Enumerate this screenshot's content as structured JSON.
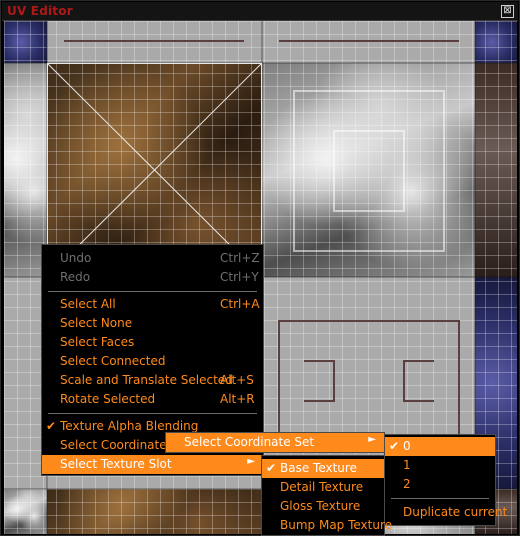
{
  "window": {
    "title": "UV Editor",
    "close_glyph": "⊠"
  },
  "colors": {
    "accent": "#ff8a1c",
    "disabled": "#6f6f6f",
    "title": "#b01818"
  },
  "context_menu": {
    "items": [
      {
        "label": "Undo",
        "shortcut": "Ctrl+Z",
        "disabled": true
      },
      {
        "label": "Redo",
        "shortcut": "Ctrl+Y",
        "disabled": true
      },
      {
        "label": "Select All",
        "shortcut": "Ctrl+A"
      },
      {
        "label": "Select None",
        "shortcut": ""
      },
      {
        "label": "Select Faces",
        "shortcut": ""
      },
      {
        "label": "Select Connected",
        "shortcut": ""
      },
      {
        "label": "Scale and Translate Selected",
        "shortcut": "Alt+S"
      },
      {
        "label": "Rotate Selected",
        "shortcut": "Alt+R"
      },
      {
        "label": "Texture Alpha Blending",
        "checked": true
      },
      {
        "label": "Select Coordinate Set",
        "submenu": true
      },
      {
        "label": "Select Texture Slot",
        "submenu": true,
        "highlighted": true
      }
    ]
  },
  "coord_set_menu": {
    "label": "Select Coordinate Set"
  },
  "coord_set_options": {
    "items": [
      {
        "label": "0",
        "checked": true
      },
      {
        "label": "1"
      },
      {
        "label": "2"
      },
      {
        "label": "Duplicate current"
      }
    ]
  },
  "texture_slot_menu": {
    "items": [
      {
        "label": "Base Texture",
        "checked": true
      },
      {
        "label": "Detail Texture"
      },
      {
        "label": "Gloss Texture"
      },
      {
        "label": "Bump Map Texture"
      }
    ]
  }
}
